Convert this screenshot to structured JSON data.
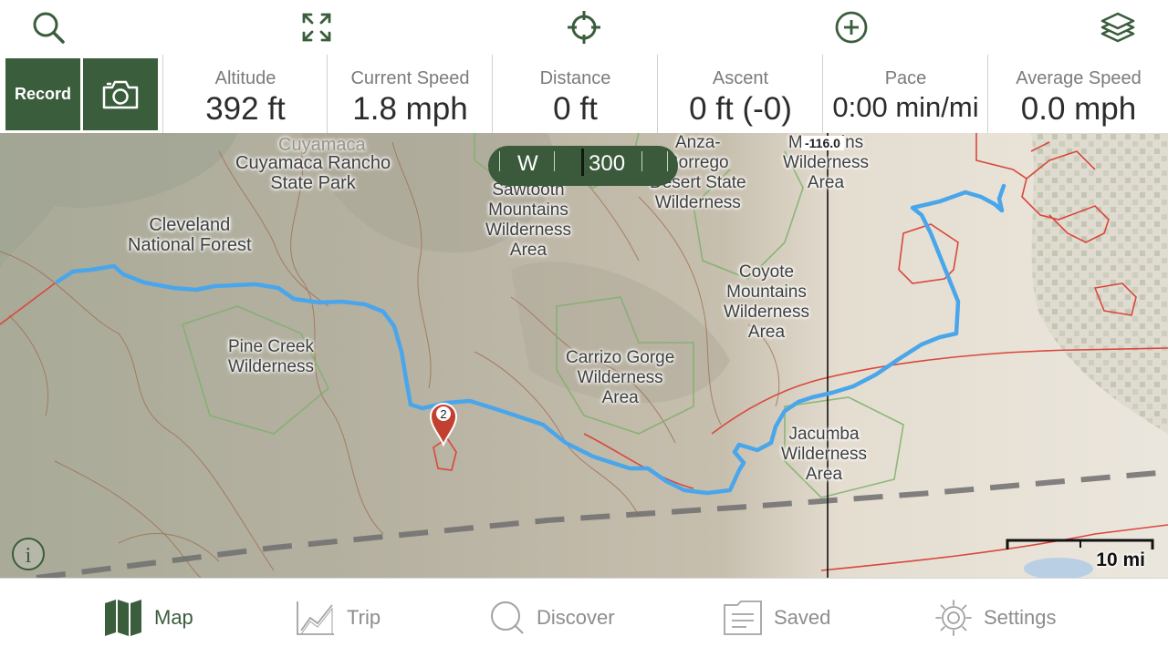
{
  "toolbar": {
    "icons": [
      "search-icon",
      "fullscreen-icon",
      "locate-icon",
      "add-icon",
      "layers-icon"
    ]
  },
  "stats_bar": {
    "record_label": "Record",
    "camera_icon": "camera-icon",
    "stats": [
      {
        "label": "Altitude",
        "value": "392 ft"
      },
      {
        "label": "Current Speed",
        "value": "1.8 mph"
      },
      {
        "label": "Distance",
        "value": "0 ft"
      },
      {
        "label": "Ascent",
        "value": "0 ft (-0)"
      },
      {
        "label": "Pace",
        "value": "0:00 min/mi"
      },
      {
        "label": "Average Speed",
        "value": "0.0 mph"
      }
    ]
  },
  "map": {
    "compass": {
      "direction": "W",
      "heading": "300"
    },
    "longitude_label": "-116.0",
    "pin_label": "2",
    "scale_label": "10 mi",
    "info_label": "i",
    "labels": {
      "cuyamaca": "Cuyamaca Rancho\nState Park",
      "cuyamaca_faint": "Cuyamaca",
      "cleveland": "Cleveland\nNational Forest",
      "pine_creek": "Pine Creek\nWilderness",
      "sawtooth": "Sawtooth\nMountains\nWilderness\nArea",
      "anza": "Anza-\nBorrego\nDesert State\nWilderness",
      "mtn_palm": "M        ins\nWilderness\nArea",
      "coyote": "Coyote\nMountains\nWilderness\nArea",
      "carrizo": "Carrizo Gorge\nWilderness\nArea",
      "jacumba": "Jacumba\nWilderness\nArea"
    },
    "colors": {
      "route": "#4aa6ea",
      "boundary_red": "#d9473c",
      "boundary_green": "#7fb06b",
      "contour": "#9c6a4c",
      "border_dash": "#6e6e6e"
    }
  },
  "bottom_nav": {
    "items": [
      {
        "label": "Map",
        "icon": "map-icon",
        "active": true
      },
      {
        "label": "Trip",
        "icon": "trip-chart-icon",
        "active": false
      },
      {
        "label": "Discover",
        "icon": "discover-icon",
        "active": false
      },
      {
        "label": "Saved",
        "icon": "saved-folder-icon",
        "active": false
      },
      {
        "label": "Settings",
        "icon": "settings-gear-icon",
        "active": false
      }
    ]
  }
}
